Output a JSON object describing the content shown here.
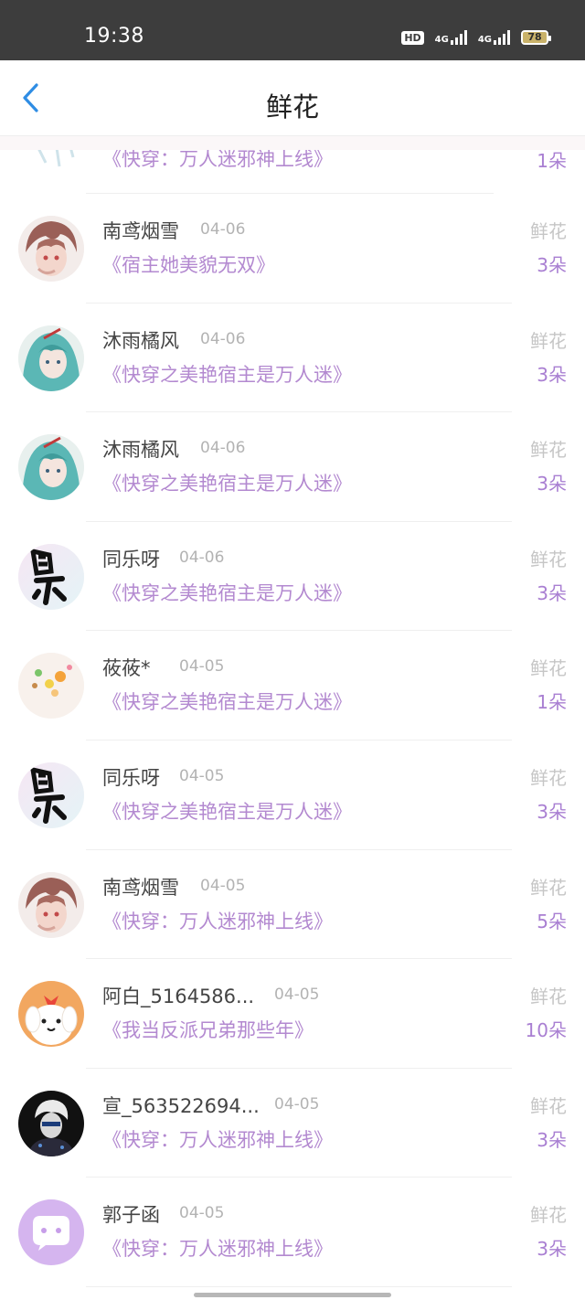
{
  "status_bar": {
    "time": "19:38",
    "hd_label": "HD",
    "network_1": "4G",
    "network_2": "4G",
    "battery": "78"
  },
  "header": {
    "title": "鲜花"
  },
  "partial_row": {
    "book": "《快穿：万人迷邪神上线》",
    "count": "1朵"
  },
  "rows": [
    {
      "name": "南鸢烟雪",
      "date": "04-06",
      "book": "《宿主她美貌无双》",
      "type": "鲜花",
      "count": "3朵",
      "avatar": "anime-boy-avatar"
    },
    {
      "name": "沐雨橘风",
      "date": "04-06",
      "book": "《快穿之美艳宿主是万人迷》",
      "type": "鲜花",
      "count": "3朵",
      "avatar": "anime-girl-avatar"
    },
    {
      "name": "沐雨橘风",
      "date": "04-06",
      "book": "《快穿之美艳宿主是万人迷》",
      "type": "鲜花",
      "count": "3朵",
      "avatar": "anime-girl-avatar"
    },
    {
      "name": "同乐呀",
      "date": "04-06",
      "book": "《快穿之美艳宿主是万人迷》",
      "type": "鲜花",
      "count": "3朵",
      "avatar": "calligraphy-avatar"
    },
    {
      "name": "莜莜*",
      "date": "04-05",
      "book": "《快穿之美艳宿主是万人迷》",
      "type": "鲜花",
      "count": "1朵",
      "avatar": "cute-stickers-avatar"
    },
    {
      "name": "同乐呀",
      "date": "04-05",
      "book": "《快穿之美艳宿主是万人迷》",
      "type": "鲜花",
      "count": "3朵",
      "avatar": "calligraphy-avatar"
    },
    {
      "name": "南鸢烟雪",
      "date": "04-05",
      "book": "《快穿：万人迷邪神上线》",
      "type": "鲜花",
      "count": "5朵",
      "avatar": "anime-boy-avatar"
    },
    {
      "name": "阿白_5164586...",
      "date": "04-05",
      "book": "《我当反派兄弟那些年》",
      "type": "鲜花",
      "count": "10朵",
      "avatar": "cartoon-dog-avatar"
    },
    {
      "name": "宣_563522694...",
      "date": "04-05",
      "book": "《快穿：万人迷邪神上线》",
      "type": "鲜花",
      "count": "3朵",
      "avatar": "dark-anime-avatar"
    },
    {
      "name": "郭子函",
      "date": "04-05",
      "book": "《快穿：万人迷邪神上线》",
      "type": "鲜花",
      "count": "3朵",
      "avatar": "default-chat-avatar"
    }
  ]
}
